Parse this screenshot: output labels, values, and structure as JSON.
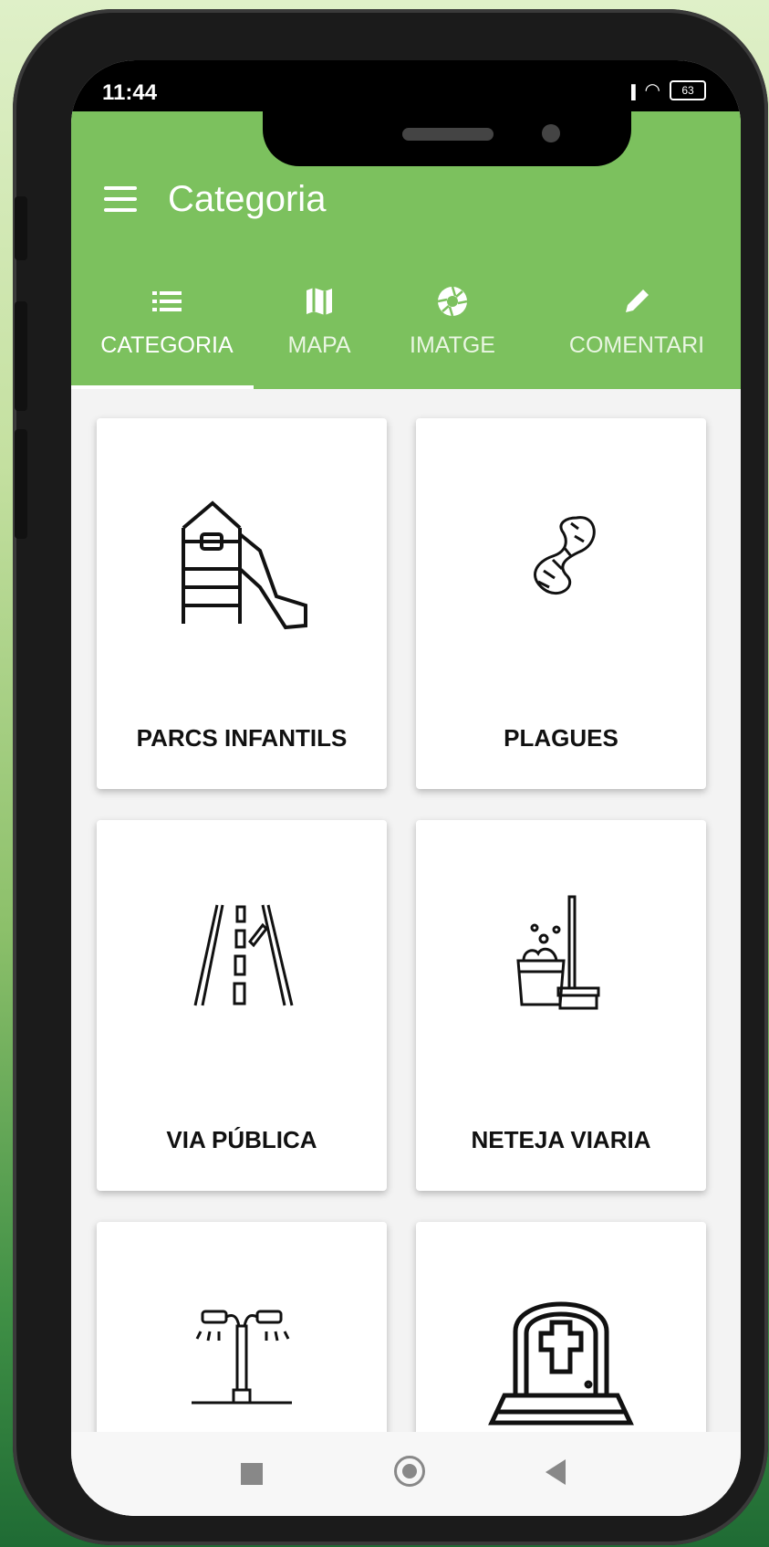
{
  "status": {
    "time": "11:44",
    "battery": "63"
  },
  "appbar": {
    "title": "Categoria"
  },
  "tabs": [
    {
      "label": "CATEGORIA",
      "icon": "list-icon",
      "active": true
    },
    {
      "label": "MAPA",
      "icon": "map-icon",
      "active": false
    },
    {
      "label": "IMATGE",
      "icon": "camera-aperture-icon",
      "active": false
    },
    {
      "label": "COMENTARI",
      "icon": "pencil-icon",
      "active": false
    }
  ],
  "categories": [
    {
      "label": "PARCS INFANTILS",
      "icon": "playground-slide-icon"
    },
    {
      "label": "PLAGUES",
      "icon": "worm-icon"
    },
    {
      "label": "VIA PÚBLICA",
      "icon": "road-icon"
    },
    {
      "label": "NETEJA VIARIA",
      "icon": "mop-bucket-icon"
    },
    {
      "label": "",
      "icon": "street-lamp-icon"
    },
    {
      "label": "",
      "icon": "tombstone-icon"
    }
  ],
  "colors": {
    "accent": "#7cc15e"
  }
}
